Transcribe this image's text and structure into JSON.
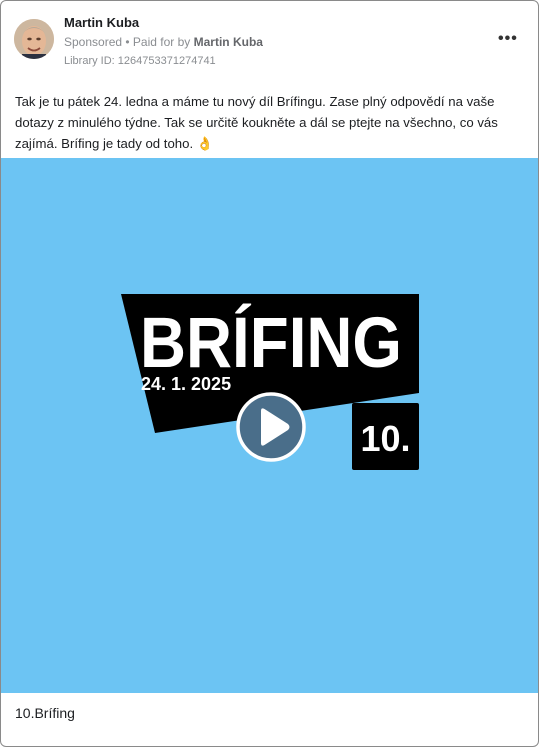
{
  "post": {
    "author": "Martin Kuba",
    "sponsored": "Sponsored",
    "paid_prefix": "• Paid for by",
    "paid_by": "Martin Kuba",
    "library_id": "Library ID: 1264753371274741",
    "more_glyph": "•••",
    "text": "Tak je tu pátek 24. ledna a máme tu nový díl Brífingu. Zase plný odpovědí na vaše dotazy z minulého týdne. Tak se určitě koukněte a dál se ptejte na všechno, co vás zajímá. Brífing je tady od toho. 👌",
    "caption": "10.Brífing"
  },
  "video": {
    "title": "BRÍFING",
    "date": "24. 1. 2025",
    "episode": "10.",
    "background_color": "#6cc4f3",
    "play_icon": "play-icon"
  }
}
